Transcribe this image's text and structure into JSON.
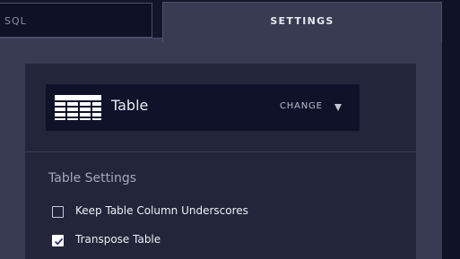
{
  "tabs": {
    "sql": {
      "label": "SQL"
    },
    "settings": {
      "label": "SETTINGS"
    }
  },
  "visualization": {
    "type_label": "Table",
    "icon": "table-icon",
    "change_label": "CHANGE"
  },
  "table_settings": {
    "heading": "Table Settings",
    "options": [
      {
        "label": "Keep Table Column Underscores",
        "checked": false
      },
      {
        "label": "Transpose Table",
        "checked": true
      }
    ]
  },
  "colors": {
    "background": "#131628",
    "panel": "#393b53",
    "card": "#23253a",
    "selector": "#0f1229",
    "text": "#eaebf2"
  }
}
